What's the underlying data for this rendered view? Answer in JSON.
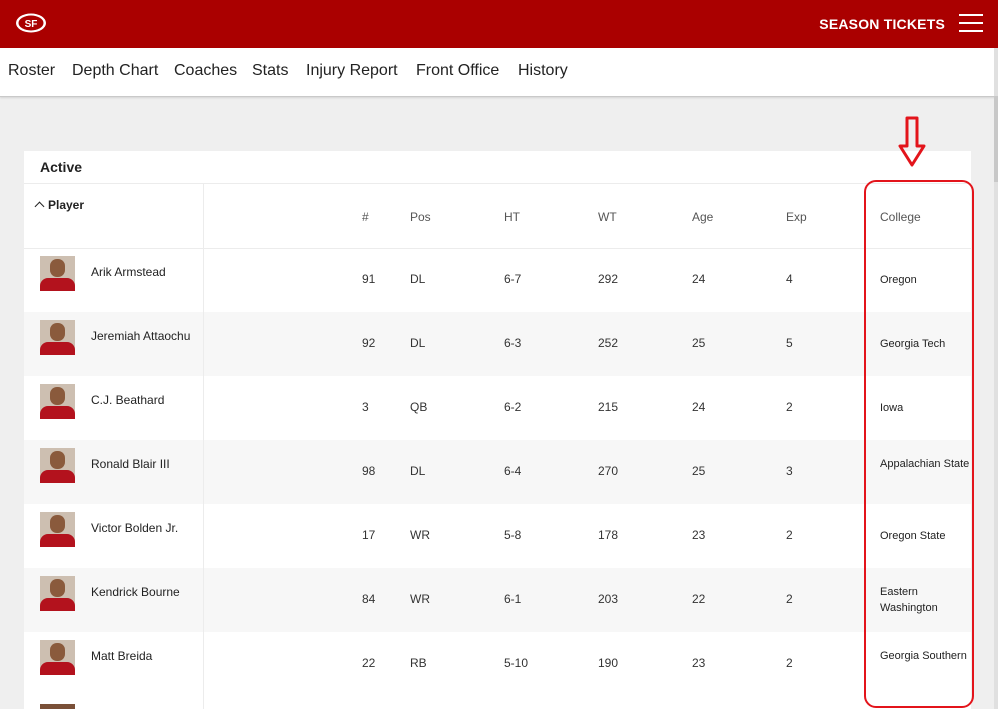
{
  "header": {
    "logo_icon": "sf-49ers-logo",
    "logo_text": "SF",
    "season_tickets": "SEASON TICKETS",
    "brand_color": "#aa0000"
  },
  "subnav": [
    "Roster",
    "Depth Chart",
    "Coaches",
    "Stats",
    "Injury Report",
    "Front Office",
    "History"
  ],
  "table": {
    "section_title": "Active",
    "headers": {
      "player": "Player",
      "num": "#",
      "pos": "Pos",
      "ht": "HT",
      "wt": "WT",
      "age": "Age",
      "exp": "Exp",
      "college": "College"
    },
    "rows": [
      {
        "name": "Arik Armstead",
        "num": "91",
        "pos": "DL",
        "ht": "6-7",
        "wt": "292",
        "age": "24",
        "exp": "4",
        "college": "Oregon"
      },
      {
        "name": "Jeremiah Attaochu",
        "num": "92",
        "pos": "DL",
        "ht": "6-3",
        "wt": "252",
        "age": "25",
        "exp": "5",
        "college": "Georgia Tech"
      },
      {
        "name": "C.J. Beathard",
        "num": "3",
        "pos": "QB",
        "ht": "6-2",
        "wt": "215",
        "age": "24",
        "exp": "2",
        "college": "Iowa"
      },
      {
        "name": "Ronald Blair III",
        "num": "98",
        "pos": "DL",
        "ht": "6-4",
        "wt": "270",
        "age": "25",
        "exp": "3",
        "college": "Appalachian State"
      },
      {
        "name": "Victor Bolden Jr.",
        "num": "17",
        "pos": "WR",
        "ht": "5-8",
        "wt": "178",
        "age": "23",
        "exp": "2",
        "college": "Oregon State"
      },
      {
        "name": "Kendrick Bourne",
        "num": "84",
        "pos": "WR",
        "ht": "6-1",
        "wt": "203",
        "age": "22",
        "exp": "2",
        "college": "Eastern Washington"
      },
      {
        "name": "Matt Breida",
        "num": "22",
        "pos": "RB",
        "ht": "5-10",
        "wt": "190",
        "age": "23",
        "exp": "2",
        "college": "Georgia Southern"
      }
    ]
  },
  "annotation": {
    "color": "#e3141b",
    "arrow_icon": "down-arrow-icon"
  }
}
